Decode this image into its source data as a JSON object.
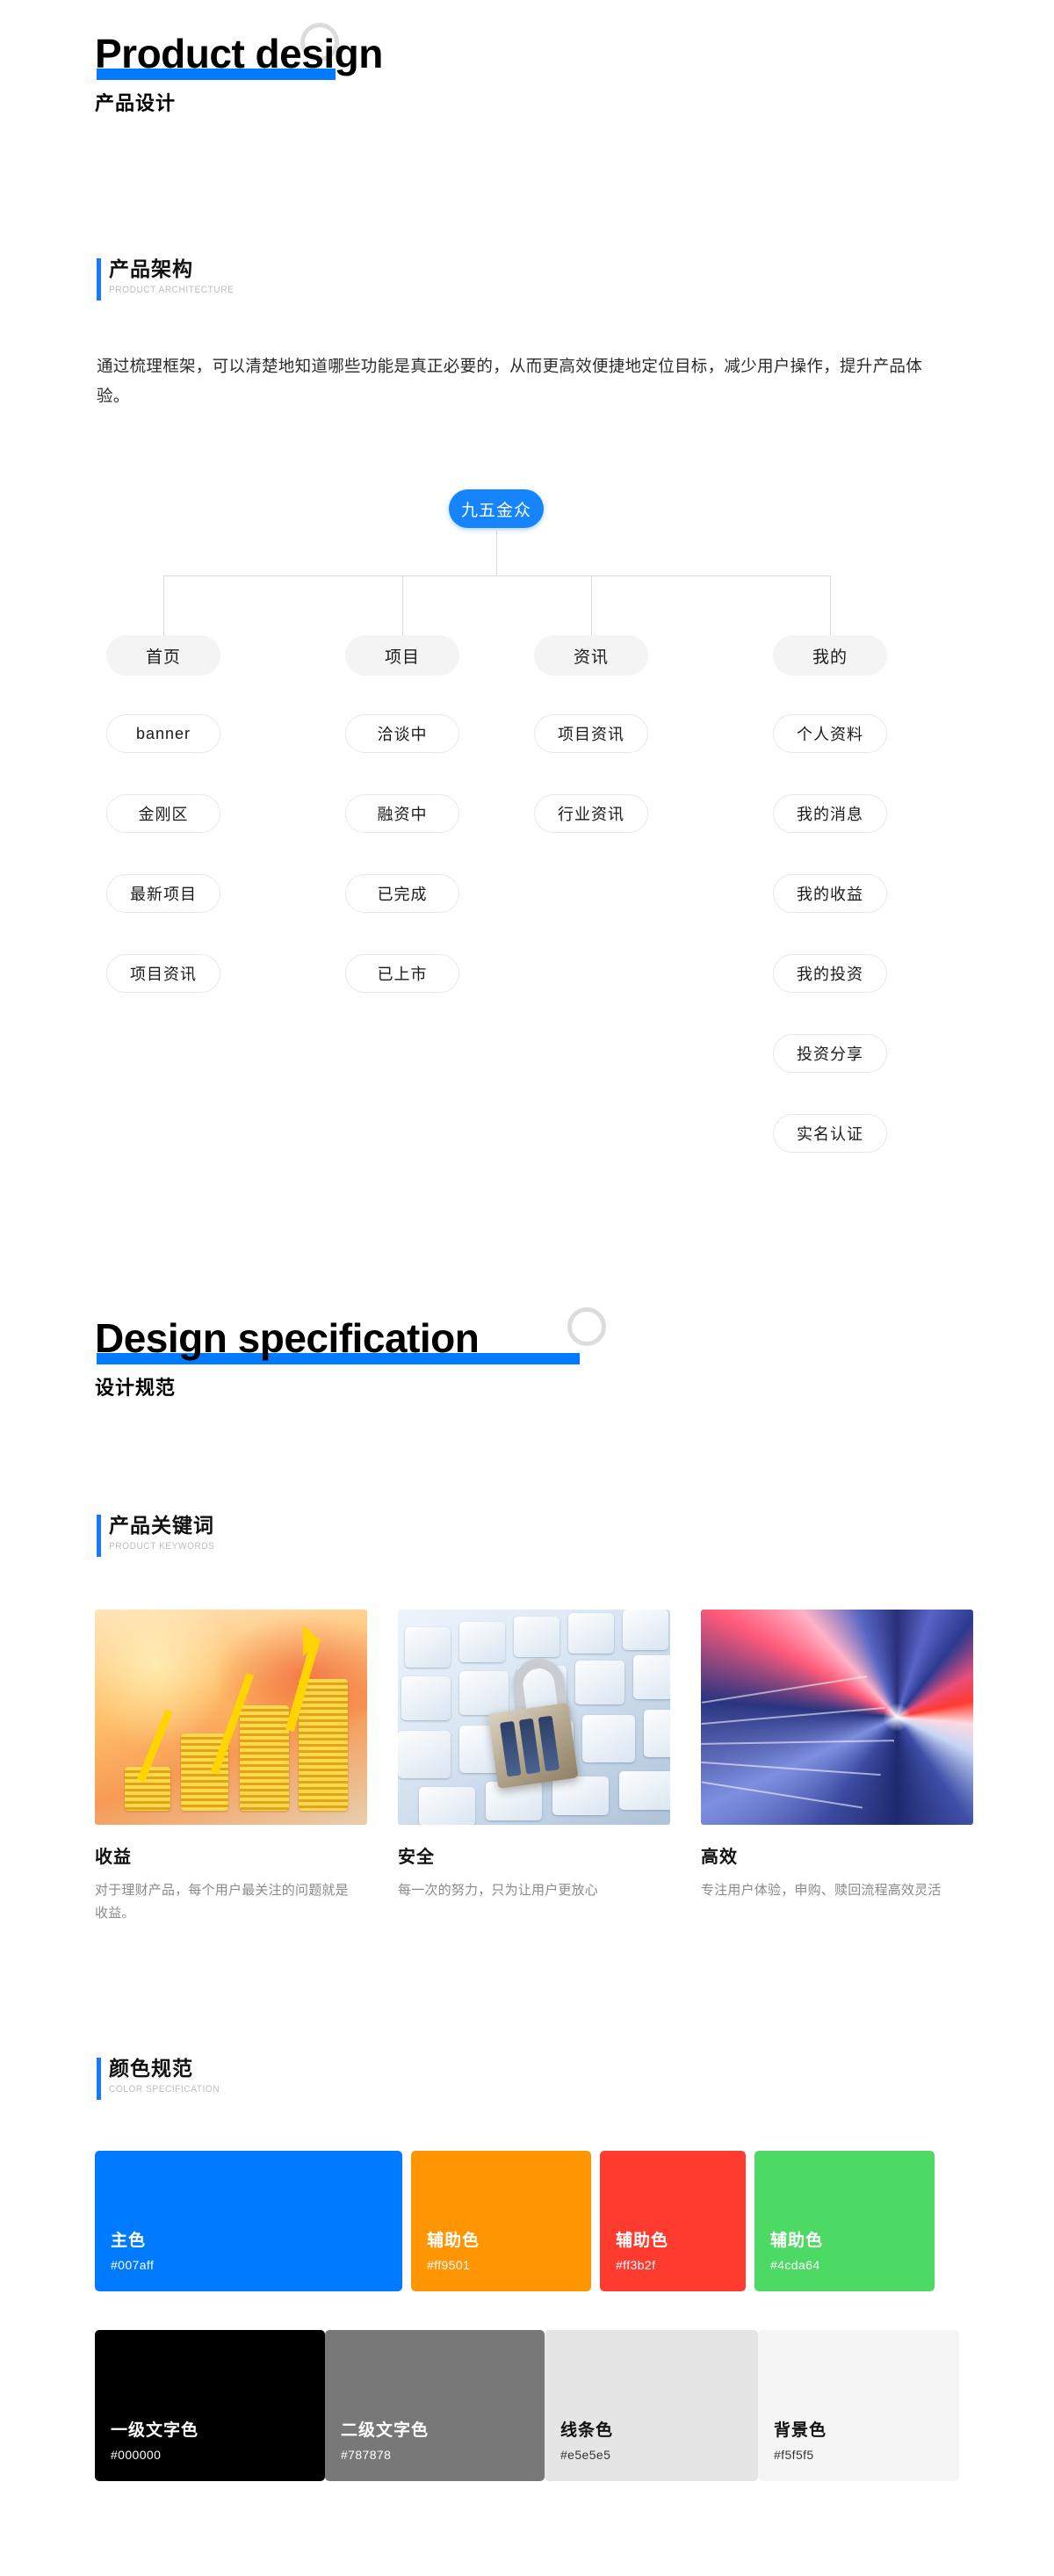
{
  "sections": {
    "product_design": {
      "en_title": "Product design",
      "cn_title": "产品设计"
    },
    "design_spec": {
      "en_title": "Design specification",
      "cn_title": "设计规范"
    }
  },
  "product_architecture": {
    "cn_title": "产品架构",
    "en_title": "PRODUCT ARCHITECTURE",
    "paragraph": "通过梳理框架，可以清楚地知道哪些功能是真正必要的，从而更高效便捷地定位目标，减少用户操作，提升产品体验。",
    "tree": {
      "root": "九五金众",
      "branches": [
        {
          "label": "首页",
          "children": [
            "banner",
            "金刚区",
            "最新项目",
            "项目资讯"
          ]
        },
        {
          "label": "项目",
          "children": [
            "洽谈中",
            "融资中",
            "已完成",
            "已上市"
          ]
        },
        {
          "label": "资讯",
          "children": [
            "项目资讯",
            "行业资讯"
          ]
        },
        {
          "label": "我的",
          "children": [
            "个人资料",
            "我的消息",
            "我的收益",
            "我的投资",
            "投资分享",
            "实名认证"
          ]
        }
      ]
    }
  },
  "product_keywords": {
    "cn_title": "产品关键词",
    "en_title": "PRODUCT KEYWORDS",
    "cards": [
      {
        "image_name": "gold-coins-growth-chart-image",
        "title": "收益",
        "desc": "对于理财产品，每个用户最关注的问题就是收益。"
      },
      {
        "image_name": "padlock-on-keyboard-image",
        "title": "安全",
        "desc": "每一次的努力，只为让用户更放心"
      },
      {
        "image_name": "motion-blur-speed-tunnel-image",
        "title": "高效",
        "desc": "专注用户体验，申购、赎回流程高效灵活"
      }
    ]
  },
  "color_specification": {
    "cn_title": "颜色规范",
    "en_title": "COLOR SPECIFICATION",
    "row1": [
      {
        "name": "主色",
        "hex": "#007aff",
        "swatch": "#007aff",
        "text": "light"
      },
      {
        "name": "辅助色",
        "hex": "#ff9501",
        "swatch": "#ff9501",
        "text": "light"
      },
      {
        "name": "辅助色",
        "hex": "#ff3b2f",
        "swatch": "#ff3b2f",
        "text": "light"
      },
      {
        "name": "辅助色",
        "hex": "#4cda64",
        "swatch": "#4cda64",
        "text": "light"
      }
    ],
    "row2": [
      {
        "name": "一级文字色",
        "hex": "#000000",
        "swatch": "#000000",
        "text": "light"
      },
      {
        "name": "二级文字色",
        "hex": "#787878",
        "swatch": "#787878",
        "text": "light"
      },
      {
        "name": "线条色",
        "hex": "#e5e5e5",
        "swatch": "#e5e5e5",
        "text": "dark"
      },
      {
        "name": "背景色",
        "hex": "#f5f5f5",
        "swatch": "#f5f5f5",
        "text": "dark"
      }
    ]
  },
  "accent_color": "#007aff"
}
